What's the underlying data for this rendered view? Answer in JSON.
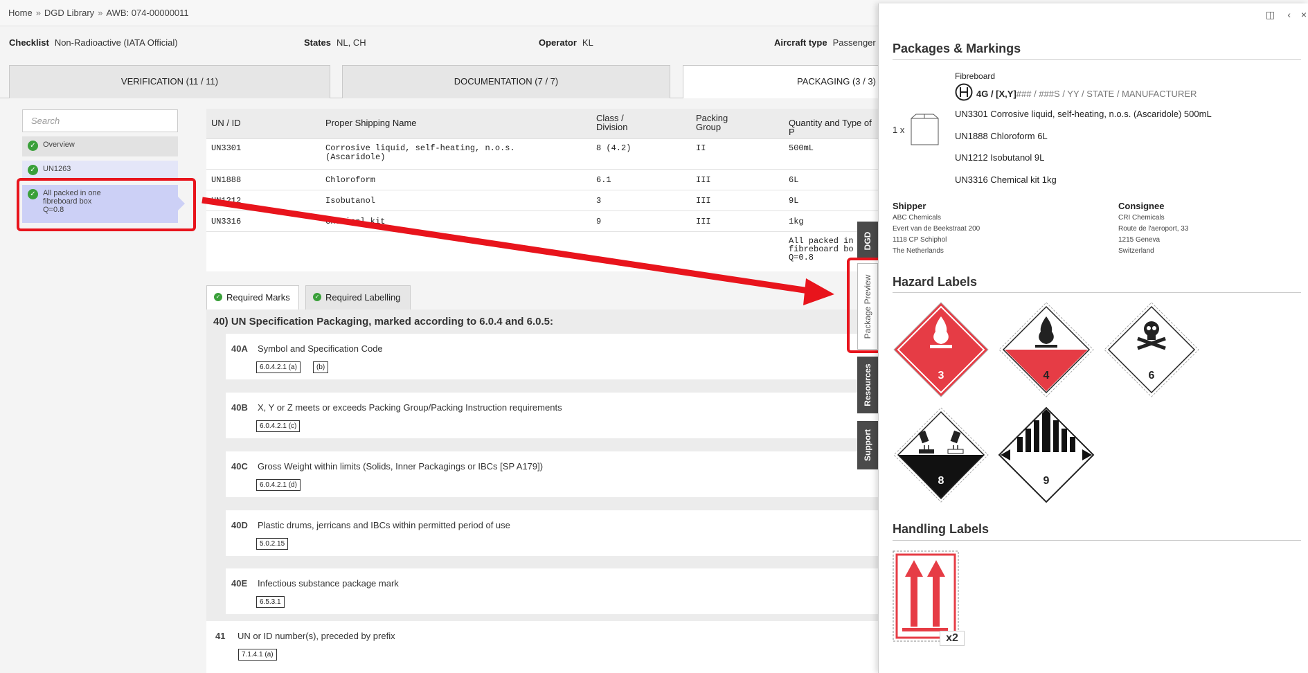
{
  "breadcrumb": {
    "home": "Home",
    "library": "DGD Library",
    "awb": "AWB: 074-00000011",
    "sep": "»"
  },
  "checklist": {
    "label": "Checklist",
    "value": "Non-Radioactive (IATA Official)"
  },
  "states": {
    "label": "States",
    "value": "NL, CH"
  },
  "operator": {
    "label": "Operator",
    "value": "KL"
  },
  "aircraft": {
    "label": "Aircraft type",
    "value": "Passenger a"
  },
  "tabs": {
    "verification": "VERIFICATION (11 / 11)",
    "documentation": "DOCUMENTATION (7 / 7)",
    "packaging": "PACKAGING (3 / 3)"
  },
  "sidebar": {
    "search_placeholder": "Search",
    "items": [
      {
        "label": "Overview"
      },
      {
        "label": "UN1263"
      },
      {
        "line1": "All packed in one",
        "line2": "fibreboard box",
        "line3": "Q=0.8"
      }
    ]
  },
  "table": {
    "headers": {
      "un": "UN / ID",
      "psn": "Proper Shipping Name",
      "class1": "Class /",
      "class2": "Division",
      "pg1": "Packing",
      "pg2": "Group",
      "qty": "Quantity and Type of P"
    },
    "rows": [
      {
        "un": "UN3301",
        "psn1": "Corrosive liquid, self-heating, n.o.s.",
        "psn2": "(Ascaridole)",
        "cls": "8 (4.2)",
        "pg": "II",
        "qty": "500mL"
      },
      {
        "un": "UN1888",
        "psn1": "Chloroform",
        "cls": "6.1",
        "pg": "III",
        "qty": "6L"
      },
      {
        "un": "UN1212",
        "psn1": "Isobutanol",
        "cls": "3",
        "pg": "III",
        "qty": "9L"
      },
      {
        "un": "UN3316",
        "psn1": "Chemical kit",
        "cls": "9",
        "pg": "III",
        "qty": "1kg"
      }
    ],
    "footer": {
      "line1": "All packed in",
      "line2": "fibreboard bo",
      "line3": "Q=0.8"
    }
  },
  "subtabs": {
    "marks": "Required Marks",
    "labelling": "Required Labelling"
  },
  "section_title": "40) UN Specification Packaging, marked according to 6.0.4 and 6.0.5:",
  "marks": [
    {
      "code": "40A",
      "title": "Symbol and Specification Code",
      "refs": [
        "6.0.4.2.1 (a)",
        "(b)"
      ]
    },
    {
      "code": "40B",
      "title": "X, Y or Z meets or exceeds Packing Group/Packing Instruction requirements",
      "refs": [
        "6.0.4.2.1 (c)"
      ]
    },
    {
      "code": "40C",
      "title": "Gross Weight within limits (Solids, Inner Packagings or IBCs [SP A179])",
      "refs": [
        "6.0.4.2.1 (d)"
      ]
    },
    {
      "code": "40D",
      "title": "Plastic drums, jerricans and IBCs within permitted period of use",
      "refs": [
        "5.0.2.15"
      ]
    },
    {
      "code": "40E",
      "title": "Infectious substance package mark",
      "refs": [
        "6.5.3.1"
      ]
    }
  ],
  "mark41": {
    "code": "41",
    "title": "UN or ID number(s), preceded by prefix",
    "ref": "7.1.4.1 (a)"
  },
  "vtabs": {
    "dgd": "DGD",
    "preview": "Package Preview",
    "resources": "Resources",
    "support": "Support"
  },
  "panel": {
    "title": "Packages & Markings",
    "material": "Fibreboard",
    "spec_main": "4G / [X,Y]",
    "spec_hash": "###",
    "spec_rest": "/  ###S  /  YY  /  STATE  /  MANUFACTURER",
    "count": "1 x",
    "contents": [
      "UN3301 Corrosive liquid, self-heating, n.o.s. (Ascaridole) 500mL",
      "UN1888 Chloroform 6L",
      "UN1212 Isobutanol 9L",
      "UN3316 Chemical kit 1kg"
    ],
    "shipper": {
      "title": "Shipper",
      "lines": [
        "ABC Chemicals",
        "Evert van de Beekstraat 200",
        "1118 CP Schiphol",
        "The Netherlands"
      ]
    },
    "consignee": {
      "title": "Consignee",
      "lines": [
        "CRI Chemicals",
        "Route de l'aeroport, 33",
        "1215 Geneva",
        "Switzerland"
      ]
    },
    "hazard_title": "Hazard Labels",
    "hazard_labels": [
      "3",
      "4",
      "6",
      "8",
      "9"
    ],
    "handling_title": "Handling Labels",
    "handling_count": "x2"
  },
  "colors": {
    "red": "#e8141c",
    "label_red": "#e63c45",
    "green": "#3aa03a"
  }
}
